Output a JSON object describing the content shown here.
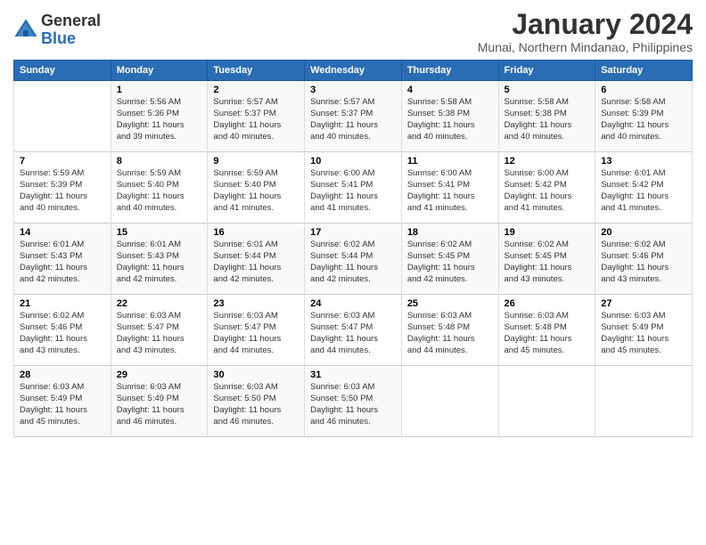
{
  "logo": {
    "general": "General",
    "blue": "Blue"
  },
  "title": "January 2024",
  "location": "Munai, Northern Mindanao, Philippines",
  "days_header": [
    "Sunday",
    "Monday",
    "Tuesday",
    "Wednesday",
    "Thursday",
    "Friday",
    "Saturday"
  ],
  "weeks": [
    [
      {
        "day": "",
        "info": ""
      },
      {
        "day": "1",
        "info": "Sunrise: 5:56 AM\nSunset: 5:36 PM\nDaylight: 11 hours\nand 39 minutes."
      },
      {
        "day": "2",
        "info": "Sunrise: 5:57 AM\nSunset: 5:37 PM\nDaylight: 11 hours\nand 40 minutes."
      },
      {
        "day": "3",
        "info": "Sunrise: 5:57 AM\nSunset: 5:37 PM\nDaylight: 11 hours\nand 40 minutes."
      },
      {
        "day": "4",
        "info": "Sunrise: 5:58 AM\nSunset: 5:38 PM\nDaylight: 11 hours\nand 40 minutes."
      },
      {
        "day": "5",
        "info": "Sunrise: 5:58 AM\nSunset: 5:38 PM\nDaylight: 11 hours\nand 40 minutes."
      },
      {
        "day": "6",
        "info": "Sunrise: 5:58 AM\nSunset: 5:39 PM\nDaylight: 11 hours\nand 40 minutes."
      }
    ],
    [
      {
        "day": "7",
        "info": "Sunrise: 5:59 AM\nSunset: 5:39 PM\nDaylight: 11 hours\nand 40 minutes."
      },
      {
        "day": "8",
        "info": "Sunrise: 5:59 AM\nSunset: 5:40 PM\nDaylight: 11 hours\nand 40 minutes."
      },
      {
        "day": "9",
        "info": "Sunrise: 5:59 AM\nSunset: 5:40 PM\nDaylight: 11 hours\nand 41 minutes."
      },
      {
        "day": "10",
        "info": "Sunrise: 6:00 AM\nSunset: 5:41 PM\nDaylight: 11 hours\nand 41 minutes."
      },
      {
        "day": "11",
        "info": "Sunrise: 6:00 AM\nSunset: 5:41 PM\nDaylight: 11 hours\nand 41 minutes."
      },
      {
        "day": "12",
        "info": "Sunrise: 6:00 AM\nSunset: 5:42 PM\nDaylight: 11 hours\nand 41 minutes."
      },
      {
        "day": "13",
        "info": "Sunrise: 6:01 AM\nSunset: 5:42 PM\nDaylight: 11 hours\nand 41 minutes."
      }
    ],
    [
      {
        "day": "14",
        "info": "Sunrise: 6:01 AM\nSunset: 5:43 PM\nDaylight: 11 hours\nand 42 minutes."
      },
      {
        "day": "15",
        "info": "Sunrise: 6:01 AM\nSunset: 5:43 PM\nDaylight: 11 hours\nand 42 minutes."
      },
      {
        "day": "16",
        "info": "Sunrise: 6:01 AM\nSunset: 5:44 PM\nDaylight: 11 hours\nand 42 minutes."
      },
      {
        "day": "17",
        "info": "Sunrise: 6:02 AM\nSunset: 5:44 PM\nDaylight: 11 hours\nand 42 minutes."
      },
      {
        "day": "18",
        "info": "Sunrise: 6:02 AM\nSunset: 5:45 PM\nDaylight: 11 hours\nand 42 minutes."
      },
      {
        "day": "19",
        "info": "Sunrise: 6:02 AM\nSunset: 5:45 PM\nDaylight: 11 hours\nand 43 minutes."
      },
      {
        "day": "20",
        "info": "Sunrise: 6:02 AM\nSunset: 5:46 PM\nDaylight: 11 hours\nand 43 minutes."
      }
    ],
    [
      {
        "day": "21",
        "info": "Sunrise: 6:02 AM\nSunset: 5:46 PM\nDaylight: 11 hours\nand 43 minutes."
      },
      {
        "day": "22",
        "info": "Sunrise: 6:03 AM\nSunset: 5:47 PM\nDaylight: 11 hours\nand 43 minutes."
      },
      {
        "day": "23",
        "info": "Sunrise: 6:03 AM\nSunset: 5:47 PM\nDaylight: 11 hours\nand 44 minutes."
      },
      {
        "day": "24",
        "info": "Sunrise: 6:03 AM\nSunset: 5:47 PM\nDaylight: 11 hours\nand 44 minutes."
      },
      {
        "day": "25",
        "info": "Sunrise: 6:03 AM\nSunset: 5:48 PM\nDaylight: 11 hours\nand 44 minutes."
      },
      {
        "day": "26",
        "info": "Sunrise: 6:03 AM\nSunset: 5:48 PM\nDaylight: 11 hours\nand 45 minutes."
      },
      {
        "day": "27",
        "info": "Sunrise: 6:03 AM\nSunset: 5:49 PM\nDaylight: 11 hours\nand 45 minutes."
      }
    ],
    [
      {
        "day": "28",
        "info": "Sunrise: 6:03 AM\nSunset: 5:49 PM\nDaylight: 11 hours\nand 45 minutes."
      },
      {
        "day": "29",
        "info": "Sunrise: 6:03 AM\nSunset: 5:49 PM\nDaylight: 11 hours\nand 46 minutes."
      },
      {
        "day": "30",
        "info": "Sunrise: 6:03 AM\nSunset: 5:50 PM\nDaylight: 11 hours\nand 46 minutes."
      },
      {
        "day": "31",
        "info": "Sunrise: 6:03 AM\nSunset: 5:50 PM\nDaylight: 11 hours\nand 46 minutes."
      },
      {
        "day": "",
        "info": ""
      },
      {
        "day": "",
        "info": ""
      },
      {
        "day": "",
        "info": ""
      }
    ]
  ]
}
